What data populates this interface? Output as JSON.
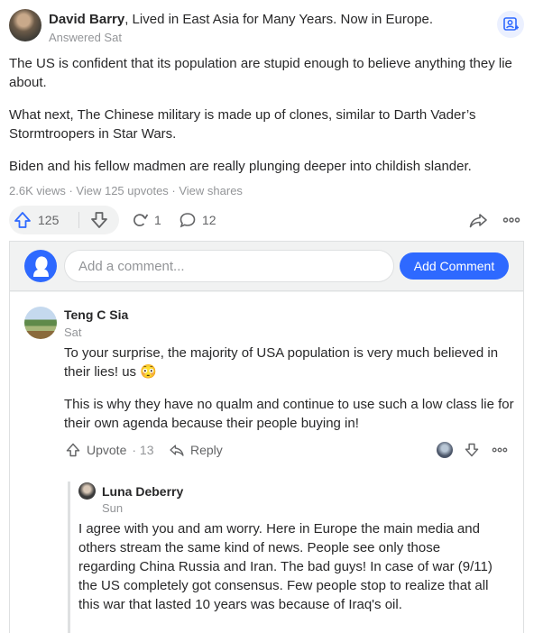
{
  "answer": {
    "author_name": "David Barry",
    "author_credential": ", Lived in East Asia for Many Years. Now in Europe.",
    "answered_label": "Answered Sat",
    "paragraphs": [
      "The US is confident that its population are stupid enough to believe anything they lie about.",
      "What next, The Chinese military is made up of clones, similar to Darth Vader’s Stormtroopers in Star Wars.",
      "Biden and his fellow madmen are really plunging deeper into childish slander."
    ],
    "stats": "2.6K views · View 125 upvotes · View shares",
    "upvote_count": "125",
    "share_count": "1",
    "comment_count": "12"
  },
  "comment_box": {
    "placeholder": "Add a comment...",
    "button_label": "Add Comment"
  },
  "comments": [
    {
      "name": "Teng C Sia",
      "date": "Sat",
      "paragraphs": [
        "To your surprise, the majority of USA population is very much believed in their lies! us 😳",
        "This is why they have no qualm and continue to use such a low class lie for their own agenda because their people buying in!"
      ],
      "upvote_label": "Upvote",
      "upvote_count": "· 13",
      "reply_label": "Reply"
    },
    {
      "name": "Luna Deberry",
      "date": "Sun",
      "text": "I agree with you and am worry. Here in Europe the main media and others stream the same kind of news. People see only those regarding China Russia and Iran. The bad guys! In case of war (9/11) the US completely got consensus. Few people stop to realize that all this war that lasted 10 years was because of Iraq's oil."
    }
  ],
  "colors": {
    "accent": "#2e69ff",
    "muted": "#939598",
    "icon": "#636466"
  }
}
